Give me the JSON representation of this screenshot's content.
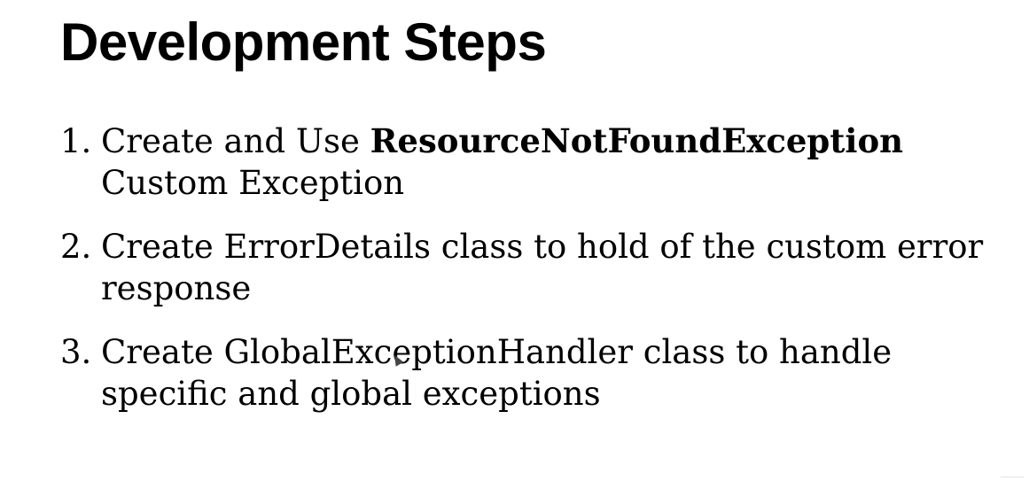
{
  "slide": {
    "title": "Development Steps",
    "steps": [
      {
        "number": "1.",
        "line1_prefix": "Create and Use ",
        "line1_bold": "ResourceNotFoundException",
        "line2": "Custom Exception"
      },
      {
        "number": "2.",
        "line1": "Create ErrorDetails class to hold of the custom error",
        "line2": "response"
      },
      {
        "number": "3.",
        "line1": "Create GlobalExceptionHandler class to handle",
        "line2": "specific and global exceptions"
      }
    ]
  }
}
